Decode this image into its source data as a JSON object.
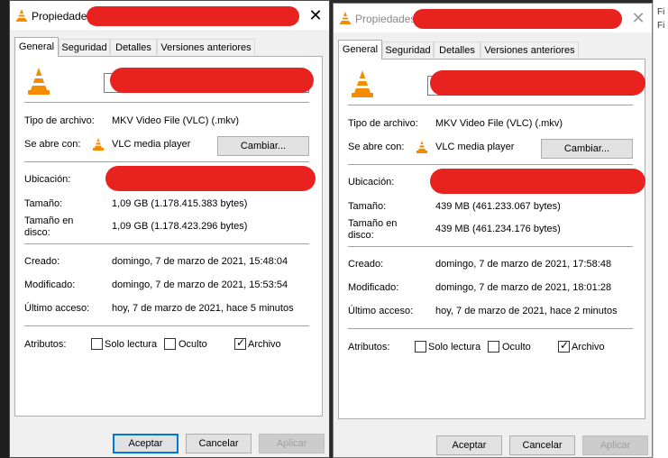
{
  "colors": {
    "redaction": "#e8231f",
    "vlc_orange": "#f48b00",
    "default_button_border": "#0078d7"
  },
  "left_window": {
    "title": "Propiedades",
    "close": "✕",
    "tabs": [
      "General",
      "Seguridad",
      "Detalles",
      "Versiones anteriores"
    ],
    "fields": {
      "type_label": "Tipo de archivo:",
      "type_value": "MKV Video File (VLC) (.mkv)",
      "opens_label": "Se abre con:",
      "opens_value": "VLC media player",
      "change_button": "Cambiar...",
      "location_label": "Ubicación:",
      "size_label": "Tamaño:",
      "size_value": "1,09 GB (1.178.415.383 bytes)",
      "disk_label_1": "Tamaño en",
      "disk_label_2": "disco:",
      "disk_value": "1,09 GB (1.178.423.296 bytes)",
      "created_label": "Creado:",
      "created_value": "domingo, 7 de marzo de 2021, 15:48:04",
      "modified_label": "Modificado:",
      "modified_value": "domingo, 7 de marzo de 2021, 15:53:54",
      "accessed_label": "Último acceso:",
      "accessed_value": "hoy, 7 de marzo de 2021, hace 5 minutos",
      "attributes_label": "Atributos:",
      "readonly_label": "Solo lectura",
      "hidden_label": "Oculto",
      "archive_label": "Archivo"
    },
    "buttons": {
      "ok": "Aceptar",
      "cancel": "Cancelar",
      "apply": "Aplicar"
    }
  },
  "right_window": {
    "title": "Propiedades",
    "close": "✕",
    "tabs": [
      "General",
      "Seguridad",
      "Detalles",
      "Versiones anteriores"
    ],
    "fields": {
      "type_label": "Tipo de archivo:",
      "type_value": "MKV Video File (VLC) (.mkv)",
      "opens_label": "Se abre con:",
      "opens_value": "VLC media player",
      "change_button": "Cambiar...",
      "location_label": "Ubicación:",
      "size_label": "Tamaño:",
      "size_value": "439 MB (461.233.067 bytes)",
      "disk_label_1": "Tamaño en",
      "disk_label_2": "disco:",
      "disk_value": "439 MB (461.234.176 bytes)",
      "created_label": "Creado:",
      "created_value": "domingo, 7 de marzo de 2021, 17:58:48",
      "modified_label": "Modificado:",
      "modified_value": "domingo, 7 de marzo de 2021, 18:01:28",
      "accessed_label": "Último acceso:",
      "accessed_value": "hoy, 7 de marzo de 2021, hace 2 minutos",
      "attributes_label": "Atributos:",
      "readonly_label": "Solo lectura",
      "hidden_label": "Oculto",
      "archive_label": "Archivo"
    },
    "buttons": {
      "ok": "Aceptar",
      "cancel": "Cancelar",
      "apply": "Aplicar"
    }
  },
  "right_edge_text": [
    "Fi",
    "Fi"
  ],
  "checkbox_state": {
    "readonly": false,
    "hidden": false,
    "archive": true
  }
}
